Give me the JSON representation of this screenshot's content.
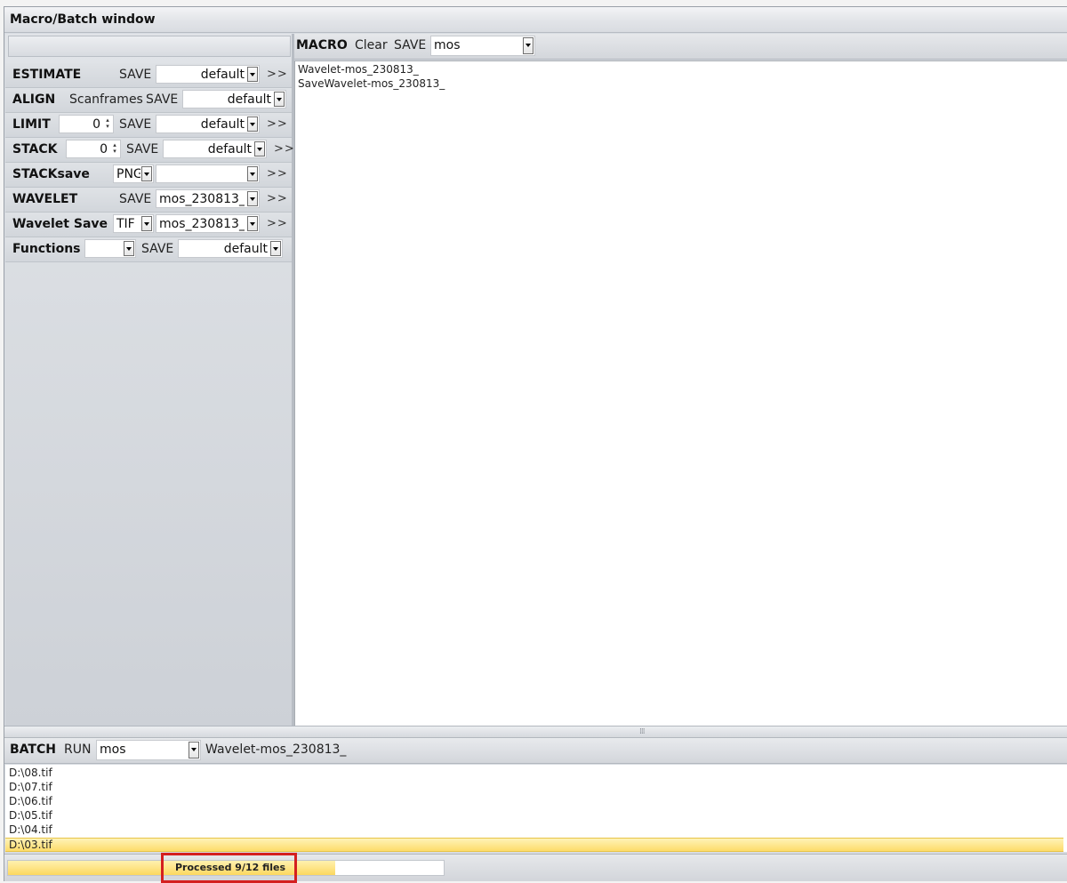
{
  "window": {
    "title": "Macro/Batch window"
  },
  "left_panel": {
    "rows": [
      {
        "label": "ESTIMATE",
        "save": "SAVE",
        "combo": "default",
        "more": ">>"
      },
      {
        "label": "ALIGN",
        "option": "Scanframes",
        "save": "SAVE",
        "combo": "default"
      },
      {
        "label": "LIMIT",
        "spin": "0",
        "save": "SAVE",
        "combo": "default",
        "more": ">>"
      },
      {
        "label": "STACK",
        "spin": "0",
        "save": "SAVE",
        "combo": "default",
        "more": ">>"
      },
      {
        "label": "STACKsave",
        "format": "PNG",
        "combo": "",
        "more": ">>"
      },
      {
        "label": "WAVELET",
        "save": "SAVE",
        "combo": "mos_230813_",
        "more": ">>"
      },
      {
        "label": "Wavelet Save",
        "format": "TIF",
        "combo": "mos_230813_",
        "more": ">>"
      },
      {
        "label": "Functions",
        "combo_func": "",
        "save": "SAVE",
        "combo": "default"
      }
    ]
  },
  "macro": {
    "label": "MACRO",
    "clear": "Clear",
    "save": "SAVE",
    "combo": "mos",
    "lines": [
      "Wavelet-mos_230813_",
      "SaveWavelet-mos_230813_"
    ]
  },
  "batch": {
    "label": "BATCH",
    "run": "RUN",
    "combo": "mos",
    "macro_name": "Wavelet-mos_230813_",
    "files": [
      "D:\\08.tif",
      "D:\\07.tif",
      "D:\\06.tif",
      "D:\\05.tif",
      "D:\\04.tif",
      "D:\\03.tif"
    ],
    "selected_index": 5
  },
  "status": {
    "text": "Processed 9/12 files",
    "progress_fraction": 0.75,
    "highlight_color": "#d41f1f"
  },
  "colors": {
    "selection": "#fddc6a",
    "progress": "#fcd85f"
  }
}
